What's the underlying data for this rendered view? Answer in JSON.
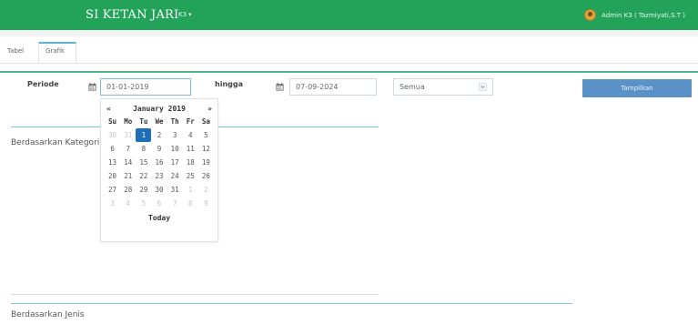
{
  "app": {
    "title": "SI KETAN JARI",
    "module_menu": "K3",
    "user": "Admin K3 ( Tazmiyati,S.T )"
  },
  "tabs": [
    {
      "label": "Tabel",
      "active": false
    },
    {
      "label": "Grafik",
      "active": true
    }
  ],
  "filter": {
    "periode_label": "Periode",
    "start_date": "01-01-2019",
    "hingga_label": "hingga",
    "end_date": "07-09-2024",
    "category_select": "Semua",
    "show_button": "Tampilkan"
  },
  "datepicker": {
    "prev": "«",
    "next": "»",
    "month_label": "January 2019",
    "weekdays": [
      "Su",
      "Mo",
      "Tu",
      "We",
      "Th",
      "Fr",
      "Sa"
    ],
    "days": [
      [
        "30",
        "31",
        "1",
        "2",
        "3",
        "4",
        "5"
      ],
      [
        "6",
        "7",
        "8",
        "9",
        "10",
        "11",
        "12"
      ],
      [
        "13",
        "14",
        "15",
        "16",
        "17",
        "18",
        "19"
      ],
      [
        "20",
        "21",
        "22",
        "23",
        "24",
        "25",
        "26"
      ],
      [
        "27",
        "28",
        "29",
        "30",
        "31",
        "1",
        "2"
      ],
      [
        "3",
        "4",
        "5",
        "6",
        "7",
        "8",
        "9"
      ]
    ],
    "muted": [
      [
        0,
        0
      ],
      [
        0,
        1
      ],
      [
        4,
        5
      ],
      [
        4,
        6
      ],
      [
        5,
        0
      ],
      [
        5,
        1
      ],
      [
        5,
        2
      ],
      [
        5,
        3
      ],
      [
        5,
        4
      ],
      [
        5,
        5
      ],
      [
        5,
        6
      ]
    ],
    "selected": [
      0,
      2
    ],
    "today_label": "Today"
  },
  "sections": {
    "kategori_title": "Berdasarkan Kategori",
    "jenis_title": "Berdasarkan Jenis"
  },
  "colors": {
    "topbar": "#23a35a",
    "accent_line": "#7cc5d9",
    "button": "#5a92c8",
    "selected_day": "#1f6fb8"
  },
  "icons": {
    "calendar": "calendar-icon",
    "select_chevron": "chevron-down-icon",
    "user_avatar": "avatar-icon"
  }
}
